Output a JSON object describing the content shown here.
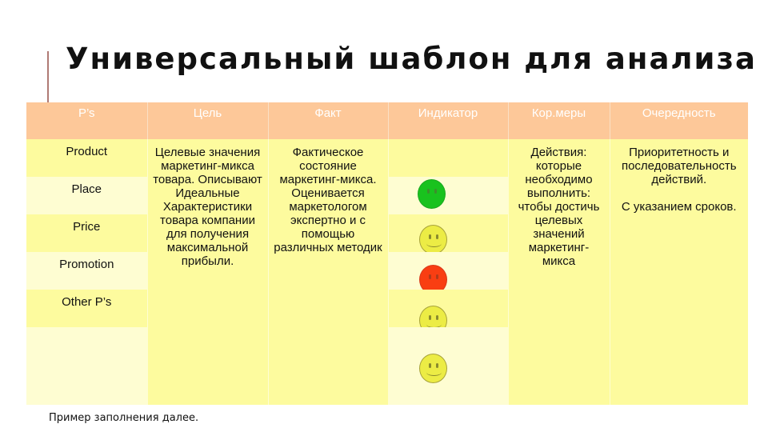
{
  "title": "Универсальный шаблон для анализа",
  "table": {
    "headers": [
      "P’s",
      "Цель",
      "Факт",
      "Индикатор",
      "Кор.меры",
      "Очередность"
    ],
    "ps_rows": [
      "Product",
      "Place",
      "Price",
      "Promotion",
      "Other P’s",
      ""
    ],
    "goal_text": "Целевые значения маркетинг-микса товара. Описывают Идеальные Характеристики товара компании для получения максимальной прибыли.",
    "fact_text": "Фактическое состояние маркетинг-микса. Оценивается маркетологом экспертно и с помощью различных методик",
    "measures_text": "Действия: которые необходимо выполнить: чтобы достичь целевых значений маркетинг-микса",
    "order_text_1": "Приоритетность и последовательность действий.",
    "order_text_2": "С указанием сроков.",
    "indicators": [
      {
        "row": "Place",
        "status": "green",
        "color": "#19c21e"
      },
      {
        "row": "Price",
        "status": "yellow",
        "color": "#ecec45"
      },
      {
        "row": "Promotion",
        "status": "red",
        "color": "#f93e12"
      },
      {
        "row": "Other P’s",
        "status": "yellow",
        "color": "#ecec45"
      },
      {
        "row": "",
        "status": "yellow",
        "color": "#ecec45"
      }
    ]
  },
  "colors": {
    "header_bg": "#fdc899",
    "band_dark": "#fdfb9e",
    "band_light": "#fefdd2",
    "accent_line": "#b07a74"
  },
  "footer": "Пример заполнения далее."
}
